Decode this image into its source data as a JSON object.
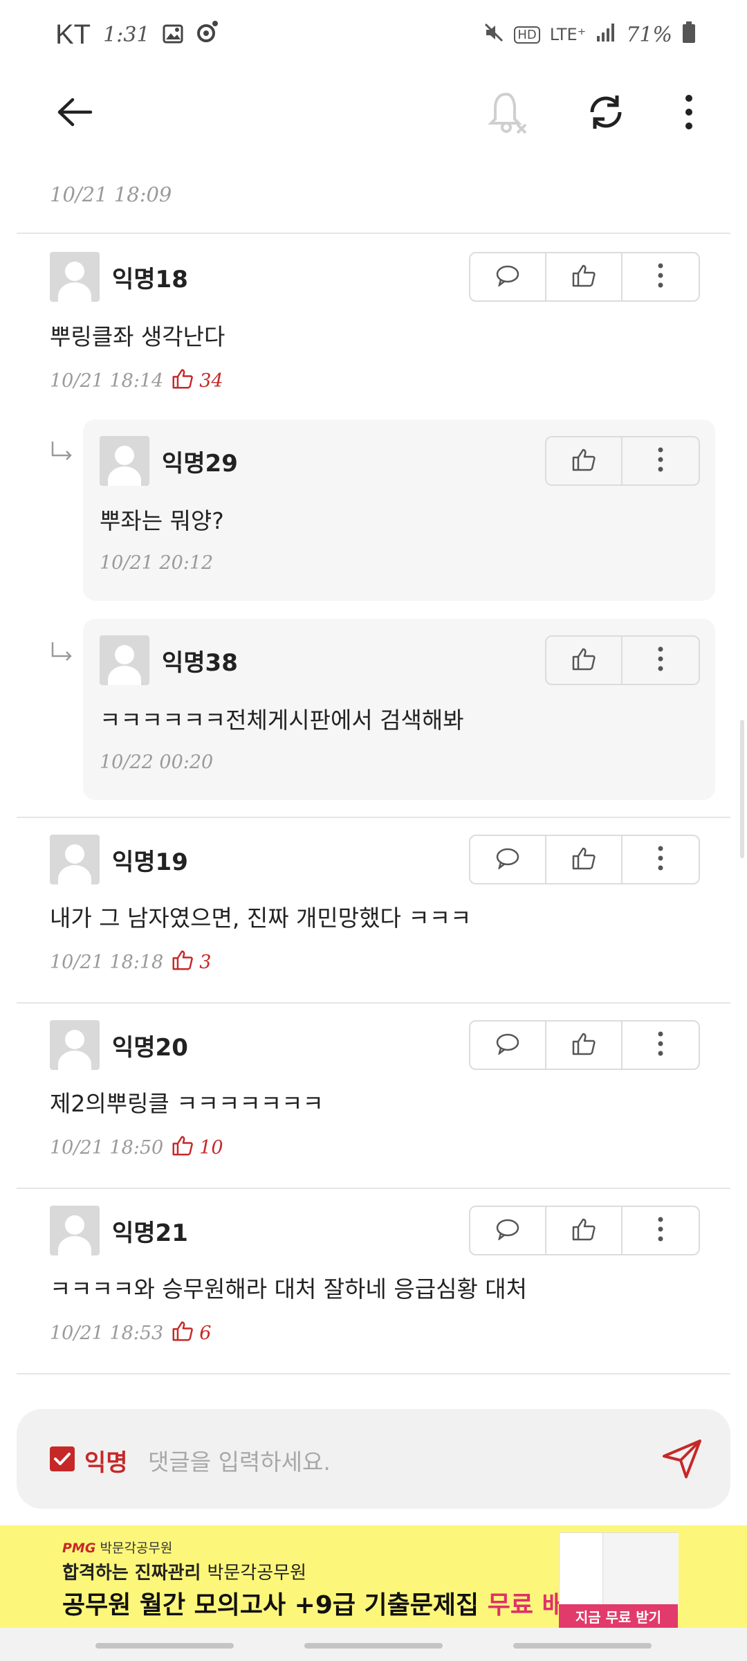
{
  "status_bar": {
    "carrier": "KT",
    "time": "1:31",
    "icons": [
      "image-icon",
      "record-icon",
      "mute-icon",
      "hd-icon",
      "lte-icon",
      "signal-icon",
      "battery-icon"
    ],
    "hd": "HD",
    "lte": "LTE⁺",
    "battery": "71%"
  },
  "app_bar": {
    "icons": [
      "back-arrow-icon",
      "notification-off-icon",
      "refresh-icon",
      "more-vert-icon"
    ]
  },
  "thread": {
    "previous_date": "10/21 18:09",
    "comments": [
      {
        "nick": "익명18",
        "text": "뿌링클좌 생각난다",
        "date": "10/21 18:14",
        "likes": "34",
        "replies": [
          {
            "nick": "익명29",
            "text": "뿌좌는 뭐양?",
            "date": "10/21 20:12"
          },
          {
            "nick": "익명38",
            "text": "ㅋㅋㅋㅋㅋㅋ전체게시판에서 검색해봐",
            "date": "10/22 00:20"
          }
        ]
      },
      {
        "nick": "익명19",
        "text": "내가 그 남자였으면, 진짜 개민망했다 ㅋㅋㅋ",
        "date": "10/21 18:18",
        "likes": "3"
      },
      {
        "nick": "익명20",
        "text": "제2의뿌링클 ㅋㅋㅋㅋㅋㅋㅋ",
        "date": "10/21 18:50",
        "likes": "10"
      },
      {
        "nick": "익명21",
        "text": "ㅋㅋㅋㅋ와 승무원해라 대처 잘하네 응급심황 대처",
        "date": "10/21 18:53",
        "likes": "6"
      }
    ]
  },
  "input_bar": {
    "anon_label": "익명",
    "anon_checked": true,
    "placeholder": "댓글을 입력하세요."
  },
  "ad": {
    "brand": "박문각공무원",
    "brand_mark": "PMG",
    "line1_bold": "합격하는 진짜관리",
    "line1_rest": "박문각공무원",
    "line2_main": "공무원 월간 모의고사 +9급 기출문제집",
    "line2_highlight": "무료 배포",
    "cta": "지금 무료 받기"
  },
  "colors": {
    "accent": "#c62828",
    "ad_background": "#fcf77a",
    "reply_background": "#f6f6f6"
  }
}
